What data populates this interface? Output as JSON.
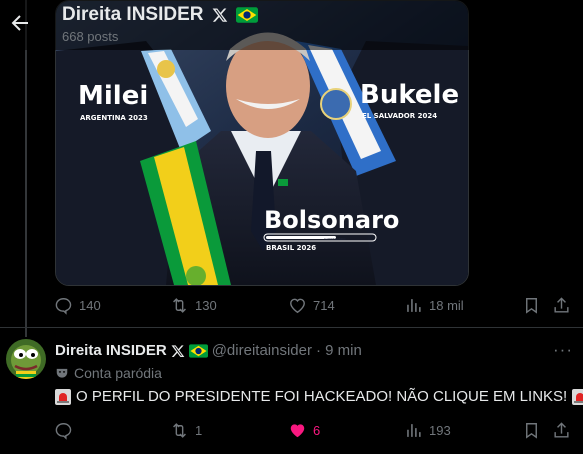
{
  "header": {
    "title": "Direita INSIDER",
    "posts": "668 posts"
  },
  "media": {
    "left_name": "Milei",
    "left_country": "ARGENTINA 2023",
    "right_name": "Bukele",
    "right_country": "EL SALVADOR 2024",
    "center_name": "Bolsonaro",
    "center_loading": "CARREGANDO",
    "center_country": "BRASIL 2026"
  },
  "actions_top": {
    "replies": "140",
    "reposts": "130",
    "likes": "714",
    "views": "18 mil"
  },
  "reply": {
    "name": "Direita INSIDER",
    "handle": "@direitainsider",
    "time": "· 9 min",
    "label": "Conta paródia",
    "text": "O PERFIL DO PRESIDENTE FOI HACKEADO! NÃO CLIQUE EM LINKS!",
    "more": "···"
  },
  "actions_bottom": {
    "replies": "",
    "reposts": "1",
    "likes": "6",
    "views": "193"
  },
  "colors": {
    "like_active": "#f91880",
    "muted": "#71767b",
    "flag_green": "#009c3b",
    "flag_yellow": "#ffdf00",
    "flag_blue": "#002776"
  }
}
